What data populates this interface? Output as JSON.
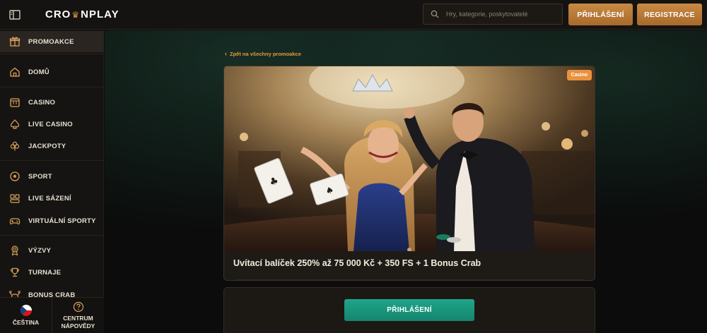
{
  "header": {
    "logo_text_left": "CRO",
    "logo_text_right": "NPLAY",
    "search_placeholder": "Hry, kategorie, poskytovatelé",
    "login_label": "PŘIHLÁŠENÍ",
    "register_label": "REGISTRACE"
  },
  "sidebar": {
    "items": [
      {
        "label": "PROMOAKCE",
        "icon": "gift-icon",
        "active": true
      },
      {
        "label": "DOMŮ",
        "icon": "home-icon"
      },
      {
        "label": "CASINO",
        "icon": "slot-machine-icon"
      },
      {
        "label": "LIVE CASINO",
        "icon": "spade-icon"
      },
      {
        "label": "JACKPOTY",
        "icon": "clover-icon"
      },
      {
        "label": "SPORT",
        "icon": "soccer-ball-icon"
      },
      {
        "label": "LIVE SÁZENÍ",
        "icon": "live-betting-icon"
      },
      {
        "label": "VIRTUÁLNÍ SPORTY",
        "icon": "gamepad-icon"
      },
      {
        "label": "VÝZVY",
        "icon": "medal-icon"
      },
      {
        "label": "TURNAJE",
        "icon": "trophy-icon"
      },
      {
        "label": "BONUS CRAB",
        "icon": "crab-icon"
      }
    ],
    "language_label": "ČEŠTINA",
    "help_label_line1": "CENTRUM",
    "help_label_line2": "NÁPOVĚDY"
  },
  "main": {
    "back_link": "Zpět na všechny promoakce",
    "promo": {
      "badge": "Casino",
      "title": "Uvítací balíček 250% až 75 000 Kč + 350 FS + 1 Bonus Crab"
    },
    "cta_label": "PŘIHLÁŠENÍ"
  },
  "colors": {
    "accent_gold": "#c88a43",
    "accent_green": "#1fa58a",
    "badge_orange": "#e9923d",
    "link_orange": "#e29a3e"
  }
}
